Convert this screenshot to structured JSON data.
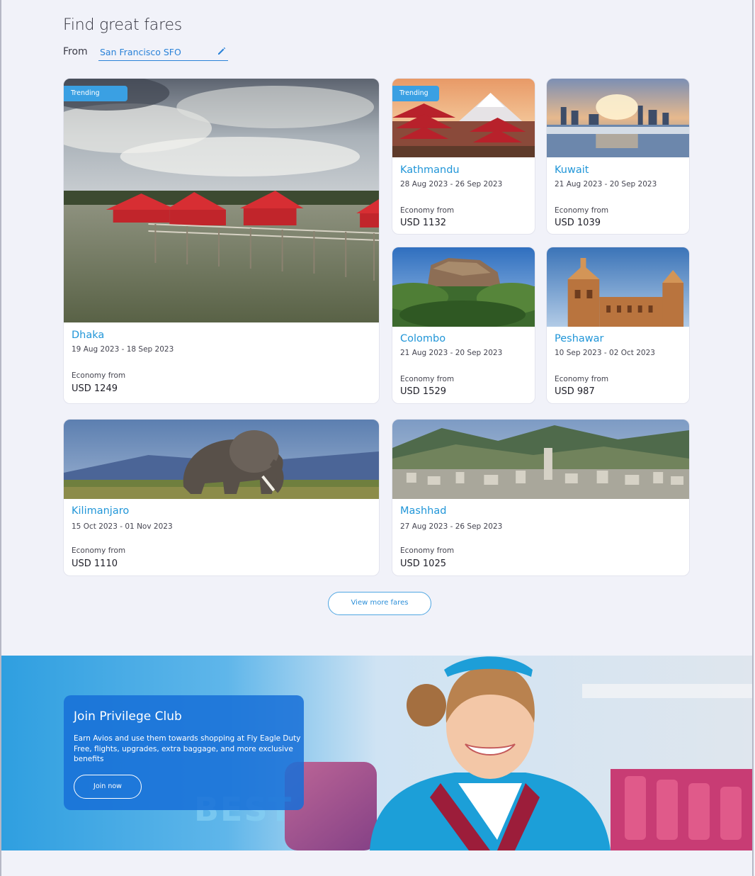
{
  "header": {
    "title": "Find great fares",
    "from_label": "From",
    "from_value": "San Francisco SFO"
  },
  "cards": [
    {
      "badge": "Trending",
      "destination": "Dhaka",
      "dates": "19 Aug 2023 - 18 Sep 2023",
      "cabin": "Economy from",
      "price": "USD 1249"
    },
    {
      "badge": "Trending",
      "destination": "Kathmandu",
      "dates": "28 Aug 2023 - 26 Sep 2023",
      "cabin": "Economy from",
      "price": "USD 1132"
    },
    {
      "destination": "Kuwait",
      "dates": "21 Aug 2023 - 20 Sep 2023",
      "cabin": "Economy from",
      "price": "USD 1039"
    },
    {
      "destination": "Colombo",
      "dates": "21 Aug 2023 - 20 Sep 2023",
      "cabin": "Economy from",
      "price": "USD 1529"
    },
    {
      "destination": "Peshawar",
      "dates": "10 Sep 2023 - 02 Oct 2023",
      "cabin": "Economy from",
      "price": "USD 987"
    },
    {
      "destination": "Kilimanjaro",
      "dates": "15 Oct 2023 - 01 Nov 2023",
      "cabin": "Economy from",
      "price": "USD 1110"
    },
    {
      "destination": "Mashhad",
      "dates": "27 Aug 2023 - 26 Sep 2023",
      "cabin": "Economy from",
      "price": "USD 1025"
    }
  ],
  "view_more_label": "View more fares",
  "promo": {
    "title": "Join Privilege Club",
    "text": "Earn Avios and use them towards shopping at Fly Eagle Duty Free, flights, upgrades, extra baggage, and more exclusive benefits",
    "button_label": "Join now",
    "backdrop_text": "BEST"
  },
  "icons": {
    "edit": "pencil-icon"
  },
  "colors": {
    "accent": "#2196d8",
    "badge": "#3aa0e3",
    "page_bg": "#f1f2f9"
  }
}
